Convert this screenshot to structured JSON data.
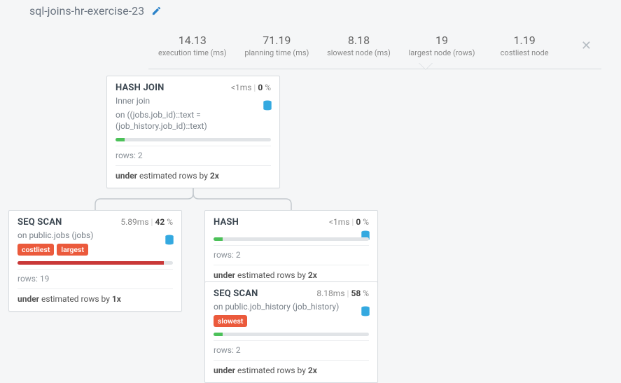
{
  "title": "sql-joins-hr-exercise-23",
  "stats": [
    {
      "value": "14.13",
      "label": "execution time (ms)"
    },
    {
      "value": "71.19",
      "label": "planning time (ms)"
    },
    {
      "value": "8.18",
      "label": "slowest node (ms)"
    },
    {
      "value": "19",
      "label": "largest node (rows)"
    },
    {
      "value": "1.19",
      "label": "costliest node"
    }
  ],
  "nodes": {
    "hashjoin": {
      "title": "HASH JOIN",
      "time_prefix": "<1",
      "time_unit": "ms",
      "pct": "0",
      "detail1": "Inner join",
      "detail2": "on ((jobs.job_id)::text = (job_history.job_id)::text)",
      "bar_fill": 6,
      "bar_color": "green",
      "rows": "rows: 2",
      "est_prefix": "under",
      "est_mid": " estimated rows by ",
      "est_factor": "2x"
    },
    "seqscan1": {
      "title": "SEQ SCAN",
      "time_prefix": "5.89",
      "time_unit": "ms",
      "pct": "42",
      "detail1": "on public.jobs (jobs)",
      "badges": [
        "costliest",
        "largest"
      ],
      "bar_fill": 94,
      "bar_color": "red",
      "rows": "rows: 19",
      "est_prefix": "under",
      "est_mid": " estimated rows by ",
      "est_factor": "1x"
    },
    "hash": {
      "title": "HASH",
      "time_prefix": "<1",
      "time_unit": "ms",
      "pct": "0",
      "bar_fill": 6,
      "bar_color": "green",
      "rows": "rows: 2",
      "est_prefix": "under",
      "est_mid": " estimated rows by ",
      "est_factor": "2x"
    },
    "seqscan2": {
      "title": "SEQ SCAN",
      "time_prefix": "8.18",
      "time_unit": "ms",
      "pct": "58",
      "detail1": "on public.job_history (job_history)",
      "badges": [
        "slowest"
      ],
      "bar_fill": 6,
      "bar_color": "green",
      "rows": "rows: 2",
      "est_prefix": "under",
      "est_mid": " estimated rows by ",
      "est_factor": "2x"
    }
  }
}
